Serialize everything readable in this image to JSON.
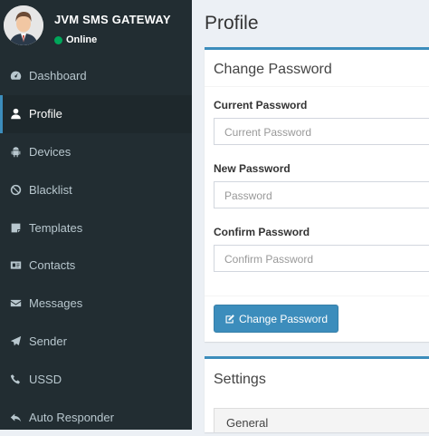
{
  "app": {
    "name": "JVM SMS GATEWAY",
    "status": "Online",
    "status_color": "#00a65a"
  },
  "sidebar": {
    "items": [
      {
        "label": "Dashboard",
        "icon": "dashboard-icon",
        "active": false
      },
      {
        "label": "Profile",
        "icon": "user-icon",
        "active": true
      },
      {
        "label": "Devices",
        "icon": "android-icon",
        "active": false
      },
      {
        "label": "Blacklist",
        "icon": "ban-icon",
        "active": false
      },
      {
        "label": "Templates",
        "icon": "sticky-note-icon",
        "active": false
      },
      {
        "label": "Contacts",
        "icon": "address-card-icon",
        "active": false
      },
      {
        "label": "Messages",
        "icon": "envelope-icon",
        "active": false
      },
      {
        "label": "Sender",
        "icon": "paper-plane-icon",
        "active": false
      },
      {
        "label": "USSD",
        "icon": "phone-icon",
        "active": false
      },
      {
        "label": "Auto Responder",
        "icon": "reply-icon",
        "active": false
      }
    ]
  },
  "page": {
    "title": "Profile"
  },
  "change_password": {
    "title": "Change Password",
    "current": {
      "label": "Current Password",
      "placeholder": "Current Password"
    },
    "new": {
      "label": "New Password",
      "placeholder": "Password"
    },
    "confirm": {
      "label": "Confirm Password",
      "placeholder": "Confirm Password"
    },
    "button": "Change Password"
  },
  "settings": {
    "title": "Settings",
    "tab": "General"
  },
  "colors": {
    "sidebar": "#222d32",
    "accent": "#3c8dbc"
  }
}
